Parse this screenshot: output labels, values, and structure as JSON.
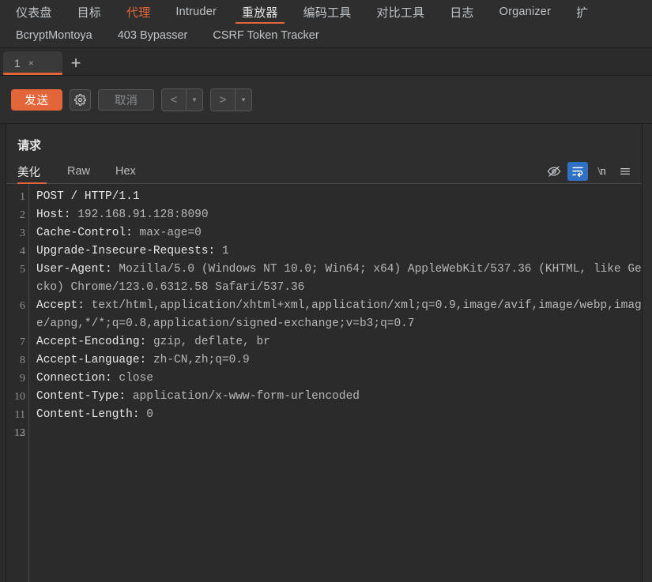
{
  "mainnav": {
    "items": [
      {
        "label": "仪表盘",
        "state": "normal",
        "cjk": true
      },
      {
        "label": "目标",
        "state": "normal",
        "cjk": true
      },
      {
        "label": "代理",
        "state": "alert",
        "cjk": true
      },
      {
        "label": "Intruder",
        "state": "normal",
        "cjk": false
      },
      {
        "label": "重放器",
        "state": "active",
        "cjk": true
      },
      {
        "label": "编码工具",
        "state": "normal",
        "cjk": true
      },
      {
        "label": "对比工具",
        "state": "normal",
        "cjk": true
      },
      {
        "label": "日志",
        "state": "normal",
        "cjk": true
      },
      {
        "label": "Organizer",
        "state": "normal",
        "cjk": false
      },
      {
        "label": "扩",
        "state": "normal",
        "cjk": true
      }
    ]
  },
  "subnav": {
    "items": [
      {
        "label": "BcryptMontoya"
      },
      {
        "label": "403 Bypasser"
      },
      {
        "label": "CSRF Token Tracker"
      }
    ]
  },
  "tabstrip": {
    "tabs": [
      {
        "label": "1",
        "close": "×"
      }
    ],
    "new_tab": "+"
  },
  "toolbar": {
    "send_label": "发送",
    "settings_icon": "gear-icon",
    "cancel_label": "取消",
    "back_glyph": "<",
    "forward_glyph": ">",
    "dropdown_glyph": "▼"
  },
  "request_panel": {
    "title": "请求",
    "tabs": [
      {
        "label": "美化",
        "active": true
      },
      {
        "label": "Raw",
        "active": false
      },
      {
        "label": "Hex",
        "active": false
      }
    ],
    "tools": [
      {
        "name": "eye-off-icon",
        "active": false
      },
      {
        "name": "word-wrap-icon",
        "active": true
      },
      {
        "name": "newline-icon",
        "label": "\\n",
        "active": false
      },
      {
        "name": "menu-icon",
        "active": false
      }
    ],
    "lines": [
      {
        "n": "1",
        "key": "POST / HTTP/1.1",
        "value": "",
        "current": false
      },
      {
        "n": "2",
        "key": "Host: ",
        "value": "192.168.91.128:8090",
        "current": false
      },
      {
        "n": "3",
        "key": "Cache-Control: ",
        "value": "max-age=0",
        "current": false
      },
      {
        "n": "4",
        "key": "Upgrade-Insecure-Requests: ",
        "value": "1",
        "current": false
      },
      {
        "n": "5",
        "key": "User-Agent: ",
        "value": "Mozilla/5.0 (Windows NT 10.0; Win64; x64) AppleWebKit/537.36 (KHTML, like Gecko) Chrome/123.0.6312.58 Safari/537.36",
        "current": false
      },
      {
        "n": "6",
        "key": "Accept: ",
        "value": "text/html,application/xhtml+xml,application/xml;q=0.9,image/avif,image/webp,image/apng,*/*;q=0.8,application/signed-exchange;v=b3;q=0.7",
        "current": false
      },
      {
        "n": "7",
        "key": "Accept-Encoding: ",
        "value": "gzip, deflate, br",
        "current": false
      },
      {
        "n": "8",
        "key": "Accept-Language: ",
        "value": "zh-CN,zh;q=0.9",
        "current": false
      },
      {
        "n": "9",
        "key": "Connection: ",
        "value": "close",
        "current": false
      },
      {
        "n": "10",
        "key": "Content-Type: ",
        "value": "application/x-www-form-urlencoded",
        "current": false
      },
      {
        "n": "11",
        "key": "Content-Length: ",
        "value": "0",
        "current": false
      },
      {
        "n": "12",
        "key": "",
        "value": "",
        "current": false
      },
      {
        "n": "13",
        "key": "",
        "value": "",
        "current": true
      }
    ]
  },
  "colors": {
    "accent_orange": "#e2663a",
    "highlight_blue": "#2f6fc4",
    "bg_app": "#2e2e2e",
    "bg_editor": "#2b2b2b",
    "current_line": "#3a4047"
  }
}
